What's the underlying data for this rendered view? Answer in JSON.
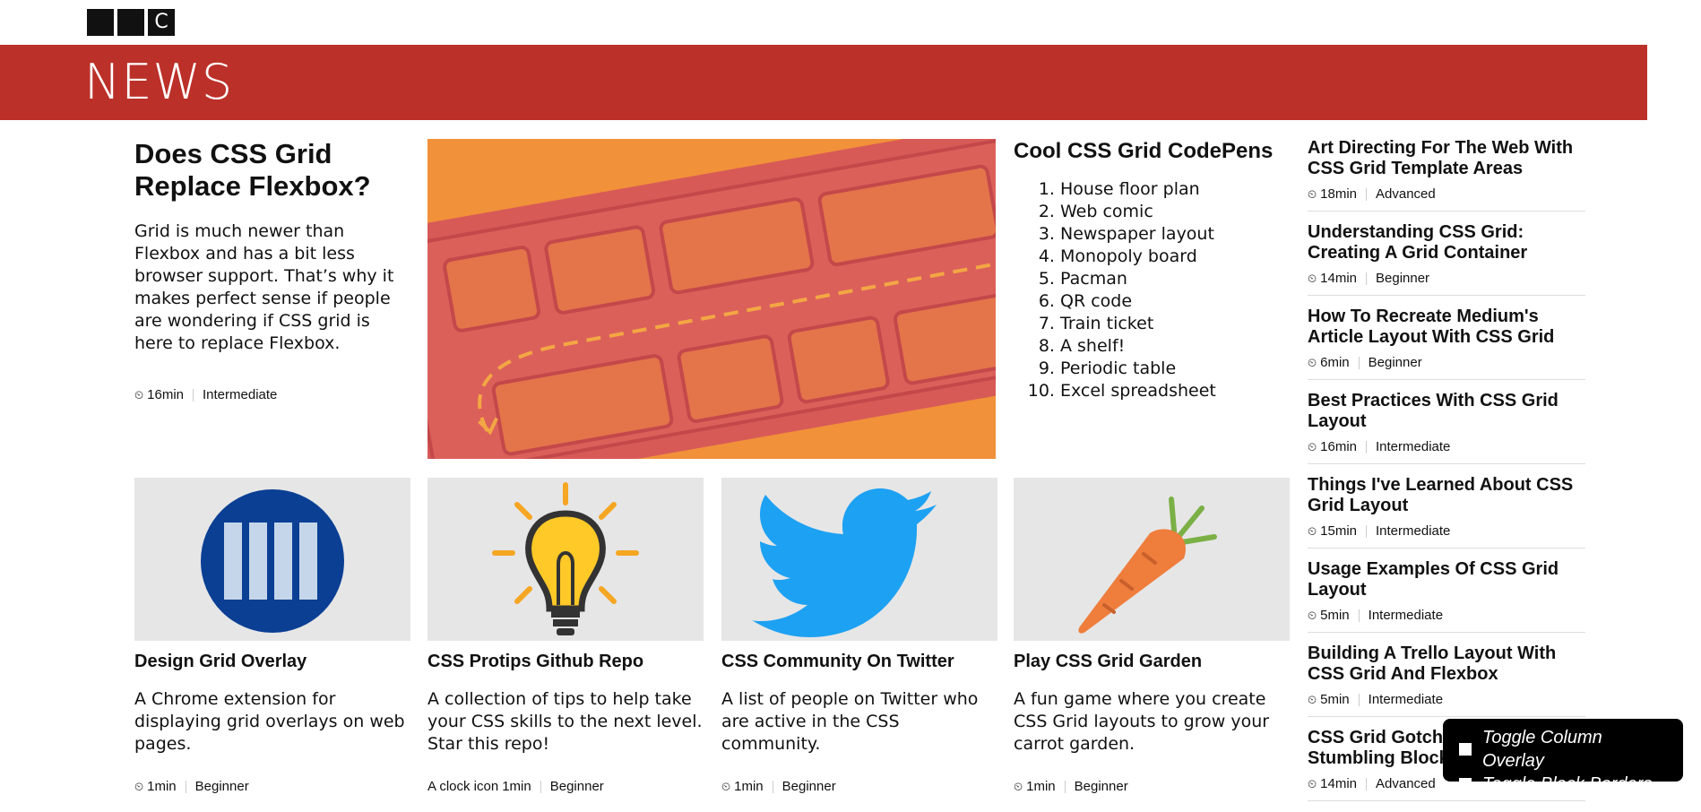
{
  "header": {
    "logo_letters": [
      "",
      "",
      "C"
    ],
    "title": "NEWS",
    "brand_color": "#bb3028"
  },
  "lead": {
    "title": "Does CSS Grid Replace Flexbox?",
    "body": "Grid is much newer than Flexbox and has a bit less browser support. That’s why it makes perfect sense if people are wondering if CSS grid is here to replace Flexbox.",
    "time": "16min",
    "level": "Intermediate"
  },
  "codepens": {
    "title": "Cool CSS Grid CodePens",
    "items": [
      "House floor plan",
      "Web comic",
      "Newspaper layout",
      "Monopoly board",
      "Pacman",
      "QR code",
      "Train ticket",
      "A shelf!",
      "Periodic table",
      "Excel spreadsheet"
    ]
  },
  "side": [
    {
      "title": "Art Directing For The Web With CSS Grid Template Areas",
      "time": "18min",
      "level": "Advanced"
    },
    {
      "title": "Understanding CSS Grid: Creating A Grid Container",
      "time": "14min",
      "level": "Beginner"
    },
    {
      "title": "How To Recreate Medium's Article Layout With CSS Grid",
      "time": "6min",
      "level": "Beginner"
    },
    {
      "title": "Best Practices With CSS Grid Layout",
      "time": "16min",
      "level": "Intermediate"
    },
    {
      "title": "Things I've Learned About CSS Grid Layout",
      "time": "15min",
      "level": "Intermediate"
    },
    {
      "title": "Usage Examples Of CSS Grid Layout",
      "time": "5min",
      "level": "Intermediate"
    },
    {
      "title": "Building A Trello Layout With CSS Grid And Flexbox",
      "time": "5min",
      "level": "Intermediate"
    },
    {
      "title": "CSS Grid Gotchas And Stumbling Blocks",
      "time": "14min",
      "level": "Advanced"
    }
  ],
  "cards": [
    {
      "title": "Design Grid Overlay",
      "body": "A Chrome extension for displaying grid overlays on web pages.",
      "time_prefix": "",
      "time": "1min",
      "level": "Beginner",
      "icon": "grid-overlay-icon"
    },
    {
      "title": "CSS Protips Github Repo",
      "body": "A collection of tips to help take your CSS skills to the next level. Star this repo!",
      "time_prefix": "A clock icon",
      "time": "1min",
      "level": "Beginner",
      "icon": "lightbulb-icon"
    },
    {
      "title": "CSS Community On Twitter",
      "body": "A list of people on Twitter who are active in the CSS community.",
      "time_prefix": "",
      "time": "1min",
      "level": "Beginner",
      "icon": "twitter-bird-icon"
    },
    {
      "title": "Play CSS Grid Garden",
      "body": "A fun game where you create CSS Grid layouts to grow your carrot garden.",
      "time_prefix": "",
      "time": "1min",
      "level": "Beginner",
      "icon": "carrot-icon"
    }
  ],
  "toggles": {
    "column_overlay": "Toggle Column Overlay",
    "block_borders": "Toggle Block Borders"
  },
  "clock_glyph": "⏲",
  "colors": {
    "hero_bg": "#f1913a",
    "twitter": "#1da1f2",
    "carrot": "#ef7d3c"
  }
}
